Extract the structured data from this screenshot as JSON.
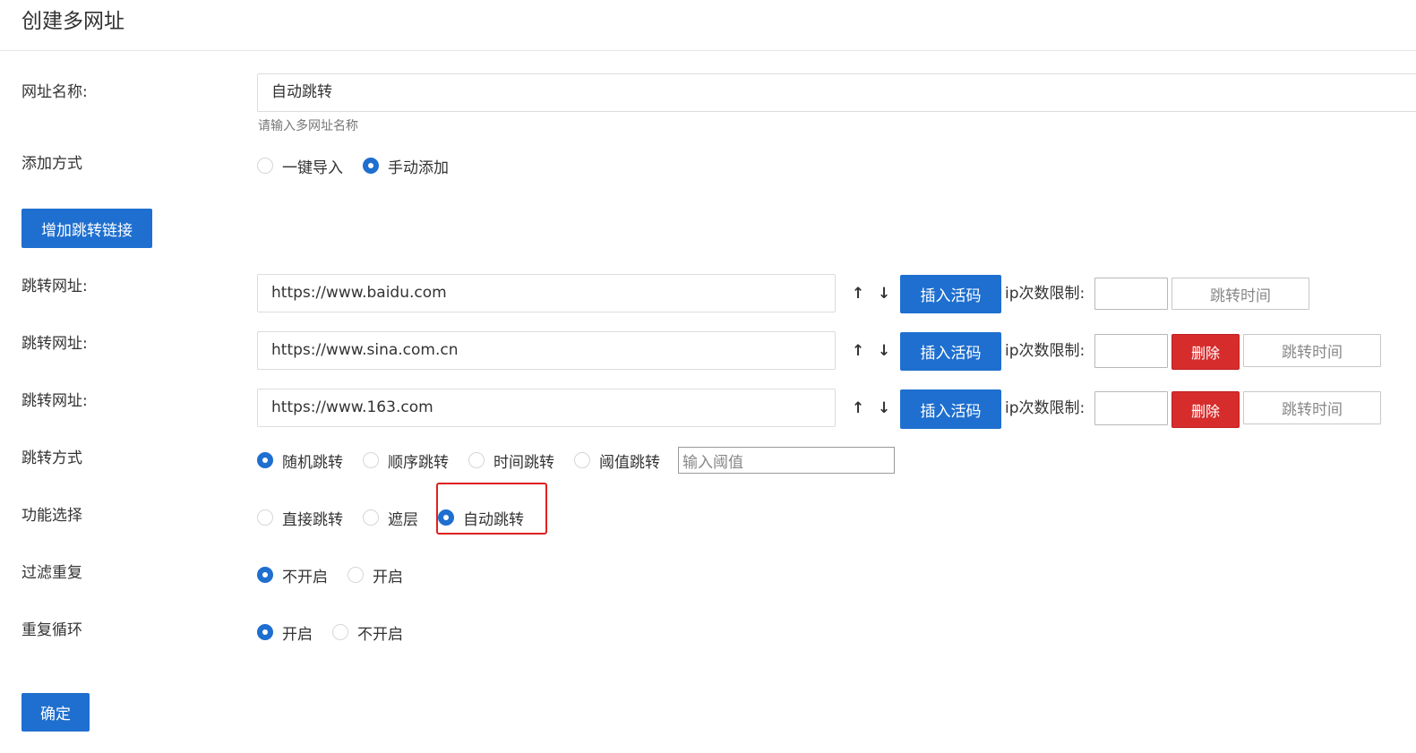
{
  "page": {
    "title": "创建多网址"
  },
  "form": {
    "name": {
      "label": "网址名称:",
      "value": "自动跳转",
      "hint": "请输入多网址名称"
    },
    "add_method": {
      "label": "添加方式",
      "options": [
        "一键导入",
        "手动添加"
      ],
      "selected": "手动添加"
    },
    "add_link_button": "增加跳转链接",
    "jump_urls": [
      {
        "label": "跳转网址:",
        "value": "https://www.baidu.com",
        "up": "↑",
        "down": "↓",
        "insert_button": "插入活码",
        "ip_label": "ip次数限制:",
        "ip_value": "",
        "time_button": "跳转时间"
      },
      {
        "label": "跳转网址:",
        "value": "https://www.sina.com.cn",
        "up": "↑",
        "down": "↓",
        "insert_button": "插入活码",
        "ip_label": "ip次数限制:",
        "ip_value": "",
        "delete_button": "删除",
        "time_button": "跳转时间"
      },
      {
        "label": "跳转网址:",
        "value": "https://www.163.com",
        "up": "↑",
        "down": "↓",
        "insert_button": "插入活码",
        "ip_label": "ip次数限制:",
        "ip_value": "",
        "delete_button": "删除",
        "time_button": "跳转时间"
      }
    ],
    "jump_method": {
      "label": "跳转方式",
      "options": [
        "随机跳转",
        "顺序跳转",
        "时间跳转",
        "阈值跳转"
      ],
      "selected": "随机跳转",
      "threshold_placeholder": "输入阈值"
    },
    "function": {
      "label": "功能选择",
      "options": [
        "直接跳转",
        "遮层",
        "自动跳转"
      ],
      "selected": "自动跳转"
    },
    "filter_repeat": {
      "label": "过滤重复",
      "options": [
        "不开启",
        "开启"
      ],
      "selected": "不开启"
    },
    "repeat_loop": {
      "label": "重复循环",
      "options": [
        "开启",
        "不开启"
      ],
      "selected": "开启"
    },
    "confirm_button": "确定"
  },
  "colors": {
    "primary": "#1e6fcf",
    "danger": "#d62c2c",
    "highlight": "#e02020"
  }
}
